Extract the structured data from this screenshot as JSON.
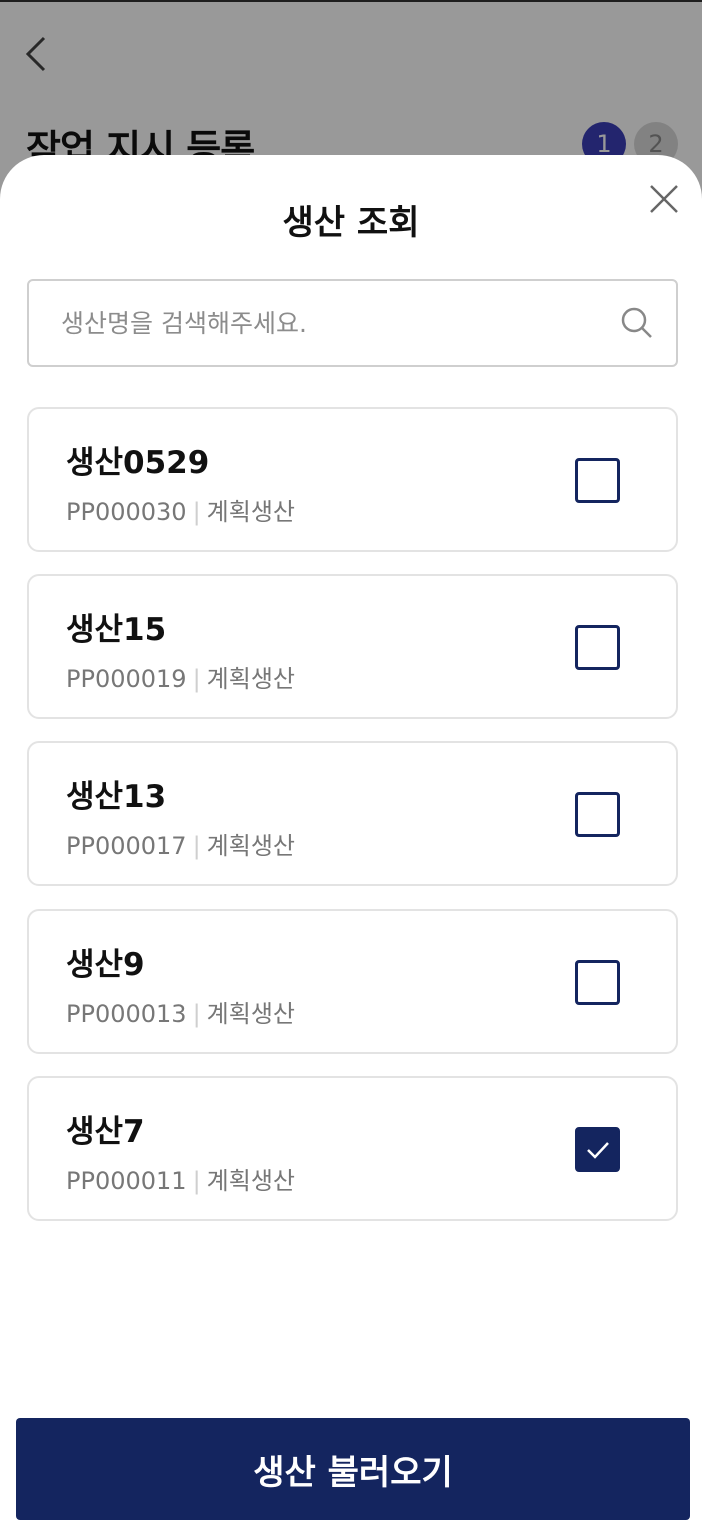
{
  "background": {
    "title": "작업 지시 등록",
    "steps": [
      "1",
      "2"
    ],
    "active_step_color": "#3b3fb8"
  },
  "sheet": {
    "title": "생산 조회",
    "search": {
      "placeholder": "생산명을 검색해주세요.",
      "value": ""
    },
    "items": [
      {
        "name": "생산0529",
        "code": "PP000030",
        "type": "계획생산",
        "checked": false
      },
      {
        "name": "생산15",
        "code": "PP000019",
        "type": "계획생산",
        "checked": false
      },
      {
        "name": "생산13",
        "code": "PP000017",
        "type": "계획생산",
        "checked": false
      },
      {
        "name": "생산9",
        "code": "PP000013",
        "type": "계획생산",
        "checked": false
      },
      {
        "name": "생산7",
        "code": "PP000011",
        "type": "계획생산",
        "checked": true
      }
    ],
    "submit_label": "생산 불러오기",
    "accent_color": "#14255f"
  }
}
